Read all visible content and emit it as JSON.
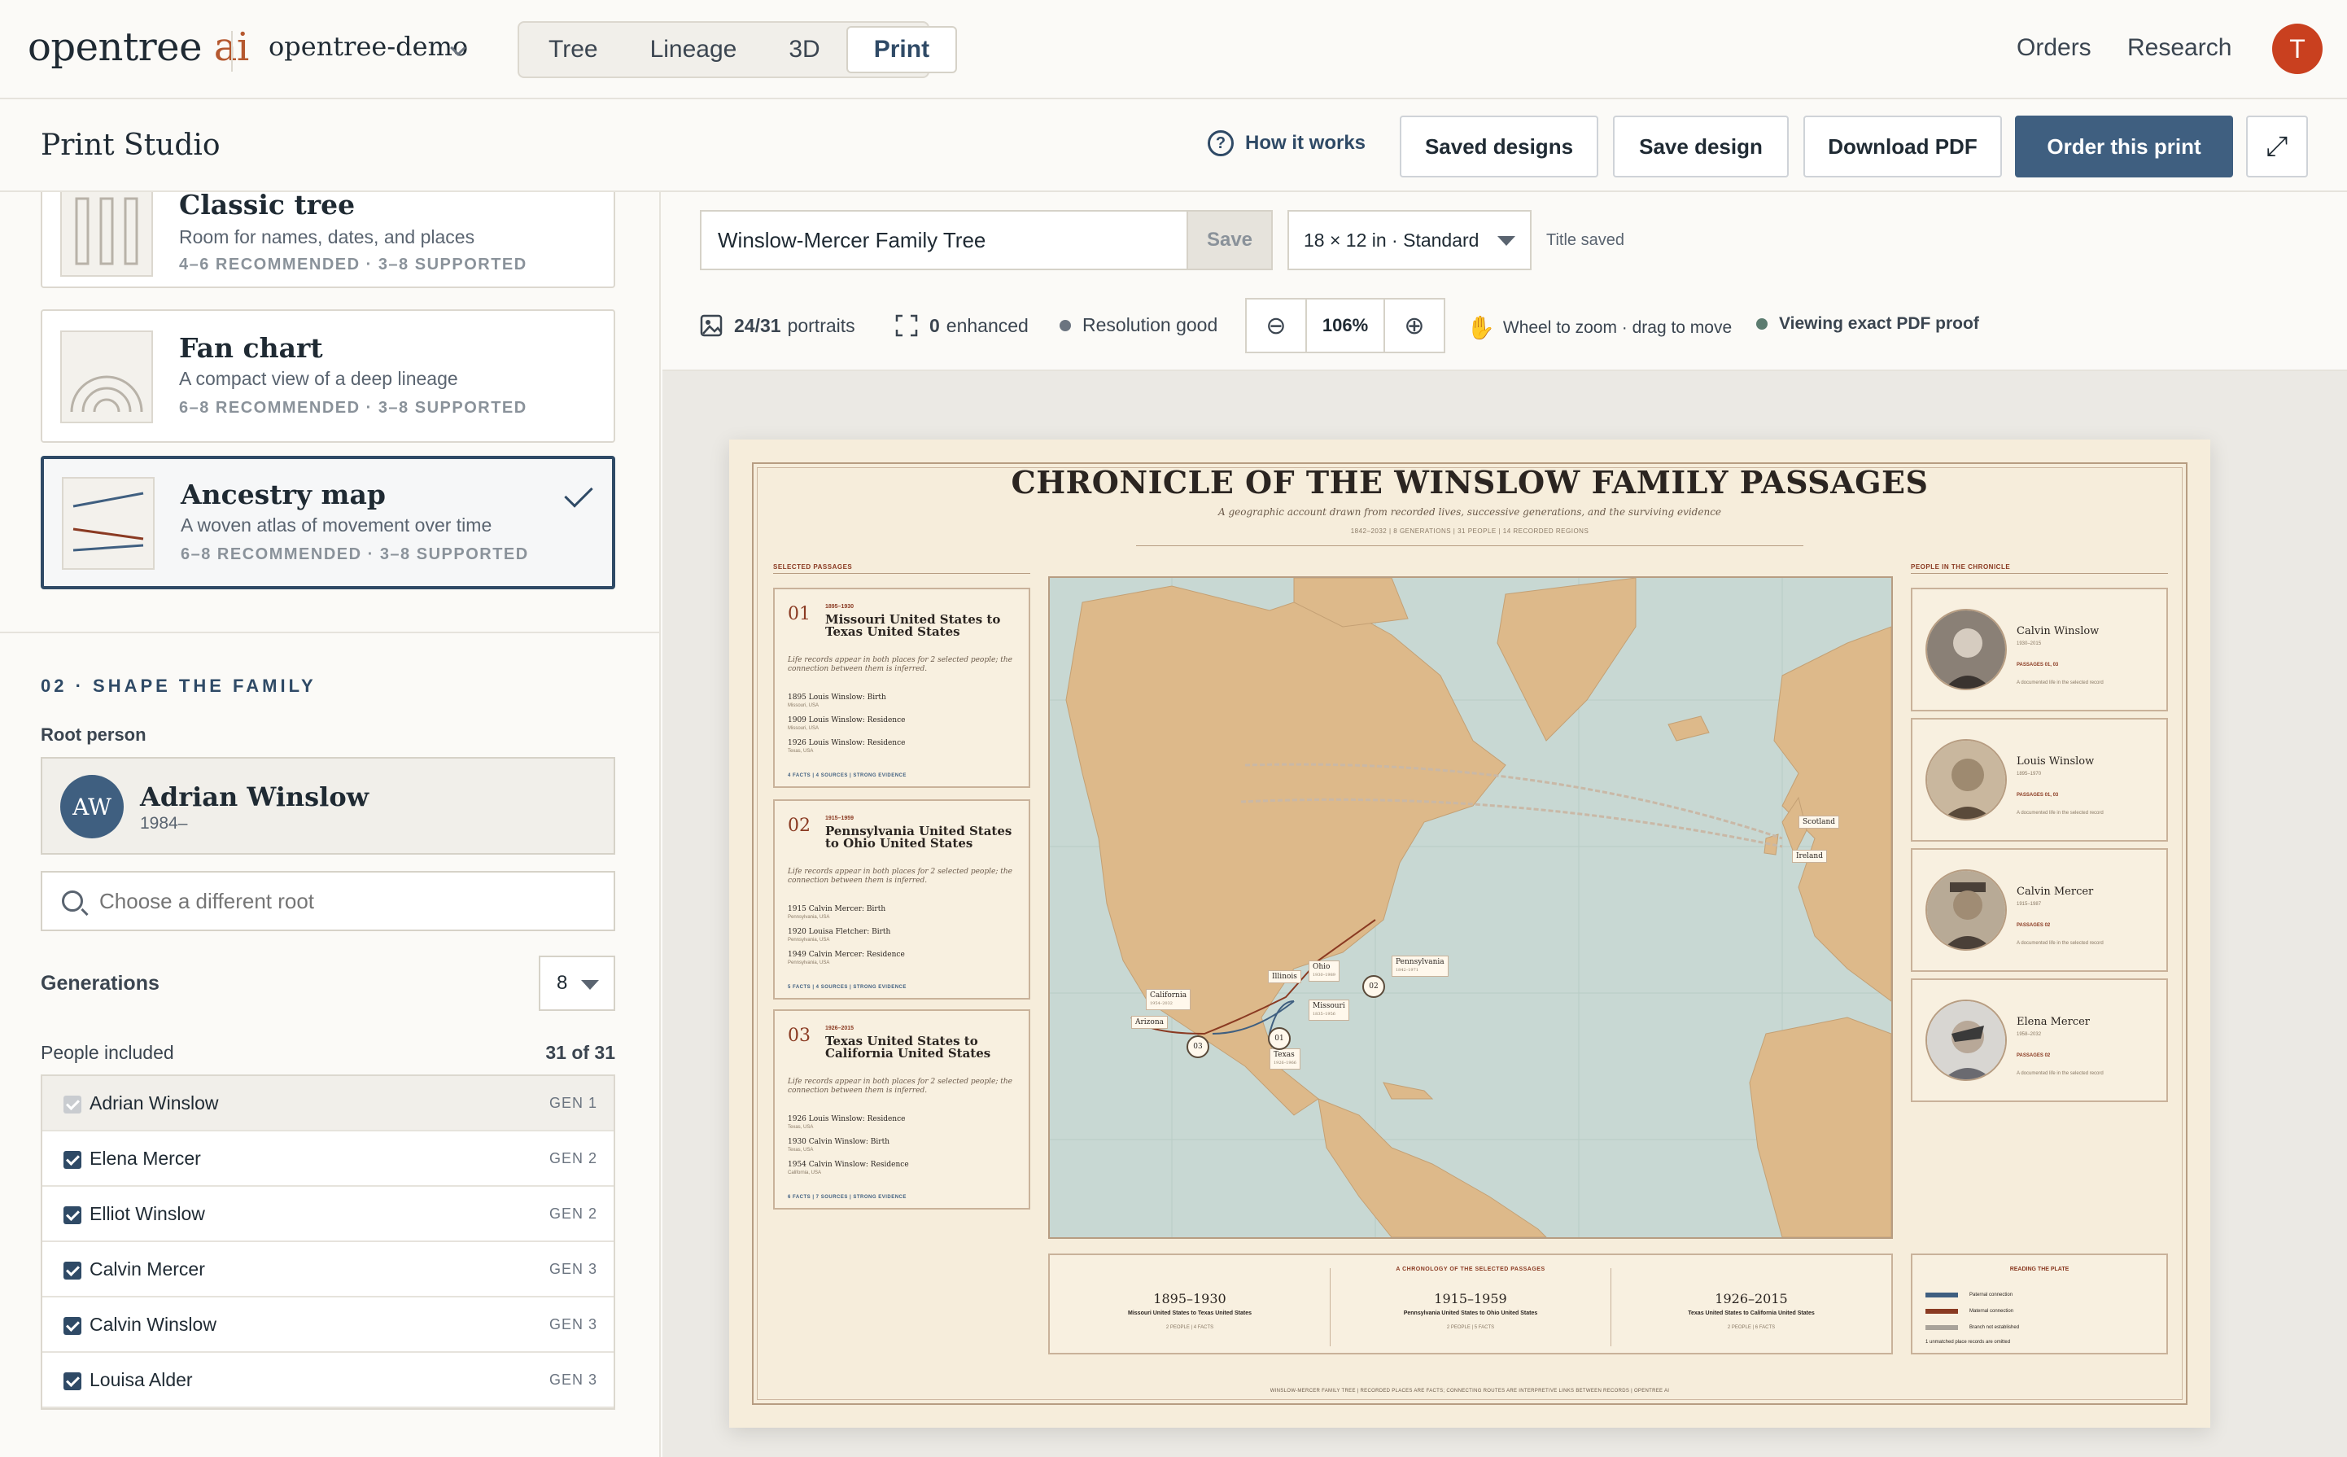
{
  "topbar": {
    "logo_main": "opentree",
    "logo_ai": "ai",
    "project": "opentree-demo",
    "tabs": [
      "Tree",
      "Lineage",
      "3D",
      "Print"
    ],
    "active_tab": "Print",
    "links": [
      "Orders",
      "Research"
    ],
    "avatar_initial": "T",
    "avatar_color": "#c9401f"
  },
  "subbar": {
    "title": "Print Studio",
    "how_it_works": "How it works",
    "saved_designs": "Saved designs",
    "save_design": "Save design",
    "download_pdf": "Download PDF",
    "order_print": "Order this print",
    "accent": "#3f5f80"
  },
  "styles": [
    {
      "title": "Classic tree",
      "desc": "Room for names, dates, and places",
      "meta": "4–6 RECOMMENDED · 3–8 SUPPORTED",
      "icon": "columns-icon"
    },
    {
      "title": "Fan chart",
      "desc": "A compact view of a deep lineage",
      "meta": "6–8 RECOMMENDED · 3–8 SUPPORTED",
      "icon": "fan-icon"
    },
    {
      "title": "Ancestry map",
      "desc": "A woven atlas of movement over time",
      "meta": "6–8 RECOMMENDED · 3–8 SUPPORTED",
      "icon": "map-lines-icon",
      "selected": true
    }
  ],
  "shape": {
    "section_title": "02 · SHAPE THE FAMILY",
    "root_label": "Root person",
    "root_initials": "AW",
    "root_name": "Adrian Winslow",
    "root_years": "1984–",
    "search_placeholder": "Choose a different root",
    "generations_label": "Generations",
    "generations_value": "8",
    "people_label": "People included",
    "people_count": "31 of 31",
    "people": [
      {
        "name": "Adrian Winslow",
        "gen": "GEN 1",
        "locked": true
      },
      {
        "name": "Elena Mercer",
        "gen": "GEN 2"
      },
      {
        "name": "Elliot Winslow",
        "gen": "GEN 2"
      },
      {
        "name": "Calvin Mercer",
        "gen": "GEN 3"
      },
      {
        "name": "Calvin Winslow",
        "gen": "GEN 3"
      },
      {
        "name": "Louisa Alder",
        "gen": "GEN 3"
      }
    ]
  },
  "workspace": {
    "title_value": "Winslow-Mercer Family Tree",
    "save_label": "Save",
    "size_value": "18 × 12 in · Standard",
    "title_saved": "Title saved",
    "portraits_num": "24/31",
    "portraits_label": "portraits",
    "enhanced_num": "0",
    "enhanced_label": "enhanced",
    "resolution": "Resolution good",
    "zoom": "106%",
    "zoom_hint": "Wheel to zoom · drag to move",
    "proof": "Viewing exact PDF proof"
  },
  "poster": {
    "title": "CHRONICLE OF THE WINSLOW FAMILY PASSAGES",
    "subtitle": "A geographic account drawn from recorded lives, successive generations, and the surviving evidence",
    "meta": "1842–2032 | 8 GENERATIONS | 31 PEOPLE | 14 RECORDED REGIONS",
    "left_section": "SELECTED PASSAGES",
    "right_section": "PEOPLE IN THE CHRONICLE",
    "passages": [
      {
        "num": "01",
        "years": "1895–1930",
        "title": "Missouri United States to Texas United States",
        "note": "Life records appear in both places for 2 selected people; the connection between them is inferred.",
        "facts": [
          [
            "1895 Louis Winslow: Birth",
            "Missouri, USA"
          ],
          [
            "1909 Louis Winslow: Residence",
            "Missouri, USA"
          ],
          [
            "1926 Louis Winslow: Residence",
            "Texas, USA"
          ]
        ],
        "foot": "4 FACTS | 4 SOURCES | STRONG EVIDENCE"
      },
      {
        "num": "02",
        "years": "1915–1959",
        "title": "Pennsylvania United States to Ohio United States",
        "note": "Life records appear in both places for 2 selected people; the connection between them is inferred.",
        "facts": [
          [
            "1915 Calvin Mercer: Birth",
            "Pennsylvania, USA"
          ],
          [
            "1920 Louisa Fletcher: Birth",
            "Pennsylvania, USA"
          ],
          [
            "1949 Calvin Mercer: Residence",
            "Pennsylvania, USA"
          ]
        ],
        "foot": "5 FACTS | 4 SOURCES | STRONG EVIDENCE"
      },
      {
        "num": "03",
        "years": "1926–2015",
        "title": "Texas United States to California United States",
        "note": "Life records appear in both places for 2 selected people; the connection between them is inferred.",
        "facts": [
          [
            "1926 Louis Winslow: Residence",
            "Texas, USA"
          ],
          [
            "1930 Calvin Winslow: Birth",
            "Texas, USA"
          ],
          [
            "1954 Calvin Winslow: Residence",
            "California, USA"
          ]
        ],
        "foot": "6 FACTS | 7 SOURCES | STRONG EVIDENCE"
      }
    ],
    "places": [
      {
        "name": "Scotland",
        "sub": ""
      },
      {
        "name": "Ireland",
        "sub": ""
      },
      {
        "name": "Pennsylvania",
        "sub": "1842–1971"
      },
      {
        "name": "Ohio",
        "sub": "1930–1989"
      },
      {
        "name": "Illinois",
        "sub": ""
      },
      {
        "name": "Missouri",
        "sub": "1835–1956"
      },
      {
        "name": "California",
        "sub": "1954–2032"
      },
      {
        "name": "Arizona",
        "sub": ""
      },
      {
        "name": "Texas",
        "sub": "1926–1966"
      }
    ],
    "route_markers": [
      "01",
      "02",
      "03"
    ],
    "chronology_title": "A CHRONOLOGY OF THE SELECTED PASSAGES",
    "chronology": [
      {
        "years": "1895–1930",
        "route": "Missouri United States to Texas United States",
        "detail": "2 PEOPLE | 4 FACTS"
      },
      {
        "years": "1915–1959",
        "route": "Pennsylvania United States to Ohio United States",
        "detail": "2 PEOPLE | 5 FACTS"
      },
      {
        "years": "1926–2015",
        "route": "Texas United States to California United States",
        "detail": "2 PEOPLE | 6 FACTS"
      }
    ],
    "people": [
      {
        "name": "Calvin Winslow",
        "years": "1930–2015",
        "passages": "PASSAGES 01, 03",
        "desc": "A documented life in the selected record"
      },
      {
        "name": "Louis Winslow",
        "years": "1895–1970",
        "passages": "PASSAGES 01, 03",
        "desc": "A documented life in the selected record"
      },
      {
        "name": "Calvin Mercer",
        "years": "1915–1987",
        "passages": "PASSAGES 02",
        "desc": "A documented life in the selected record"
      },
      {
        "name": "Elena Mercer",
        "years": "1958–2032",
        "passages": "PASSAGES 02",
        "desc": "A documented life in the selected record"
      }
    ],
    "legend_title": "READING THE PLATE",
    "legend": [
      {
        "label": "Paternal connection",
        "color": "#3f5f80"
      },
      {
        "label": "Maternal connection",
        "color": "#8a3a22"
      },
      {
        "label": "Branch not established",
        "color": "#a9a39a"
      },
      {
        "label": "1 unmatched place records are omitted",
        "color": ""
      }
    ],
    "footer": "WINSLOW-MERCER FAMILY TREE | RECORDED PLACES ARE FACTS; CONNECTING ROUTES ARE INTERPRETIVE LINKS BETWEEN RECORDS | OPENTREE AI",
    "ocean_color": "#c8d8d3",
    "land_color": "#ddb98a"
  }
}
